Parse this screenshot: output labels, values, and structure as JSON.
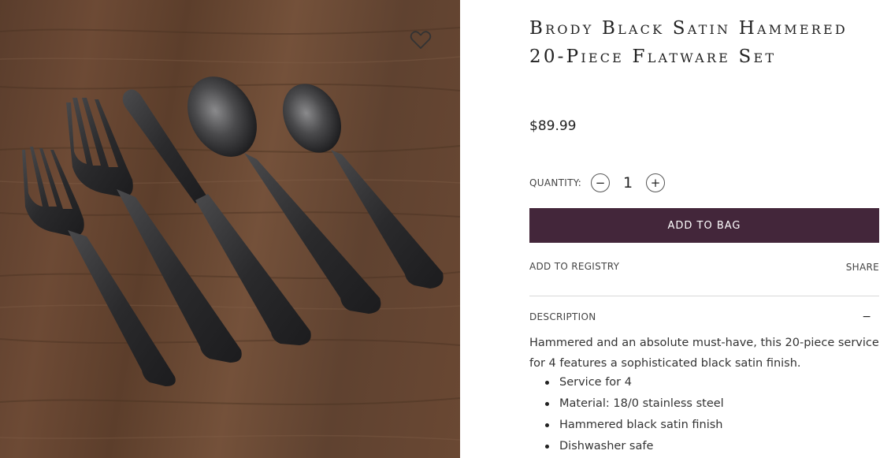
{
  "product": {
    "title": "Brody Black Satin Hammered 20-Piece Flatware Set",
    "price": "$89.99",
    "image_alt": "Black satin hammered flatware place setting on wooden table"
  },
  "purchase": {
    "quantity_label": "QUANTITY:",
    "quantity_value": "1",
    "decrement_symbol": "−",
    "increment_symbol": "+",
    "add_to_bag_label": "ADD TO BAG",
    "add_to_registry_label": "ADD TO REGISTRY",
    "share_label": "SHARE"
  },
  "description": {
    "heading": "DESCRIPTION",
    "toggle_symbol": "−",
    "text": "Hammered and an absolute must-have, this 20-piece service for 4 features a sophisticated black satin finish.",
    "features": [
      "Service for 4",
      "Material: 18/0 stainless steel",
      "Hammered black satin finish",
      "Dishwasher safe"
    ]
  },
  "icons": {
    "wishlist": "heart-outline-icon"
  },
  "colors": {
    "add_to_bag_bg": "#43263a",
    "add_to_bag_text": "#ffffff"
  }
}
